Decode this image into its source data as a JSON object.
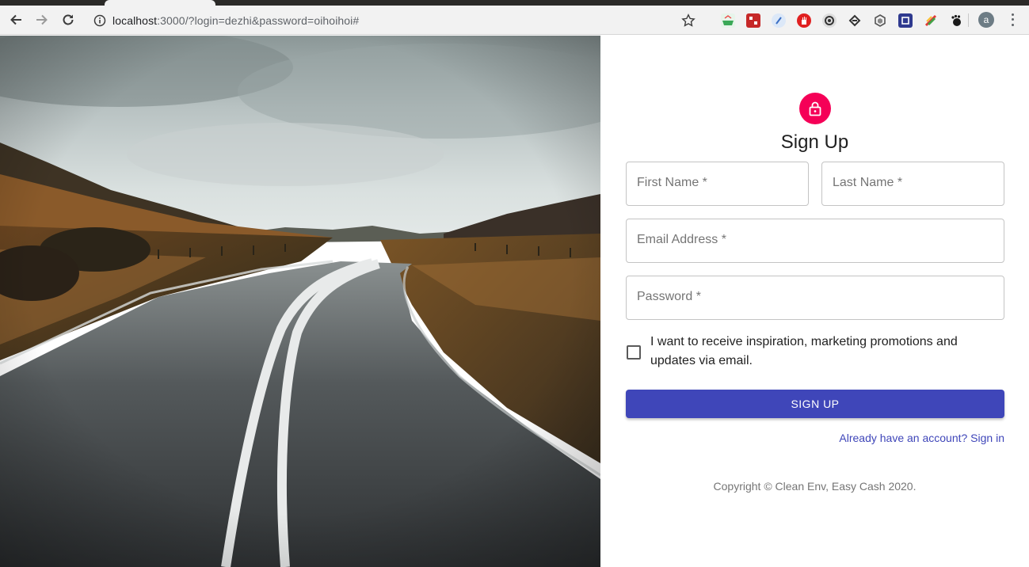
{
  "browser": {
    "url_host": "localhost",
    "url_rest": ":3000/?login=dezhi&password=oihoihoi#",
    "avatar_letter": "a"
  },
  "form": {
    "title": "Sign Up",
    "first_name_label": "First Name *",
    "last_name_label": "Last Name *",
    "email_label": "Email Address *",
    "password_label": "Password *",
    "checkbox_label": "I want to receive inspiration, marketing promotions and updates via email.",
    "submit_label": "SIGN UP",
    "signin_link": "Already have an account? Sign in",
    "copyright": "Copyright © Clean Env, Easy Cash 2020."
  },
  "colors": {
    "accent": "#f50057",
    "primary": "#3f46b9"
  }
}
